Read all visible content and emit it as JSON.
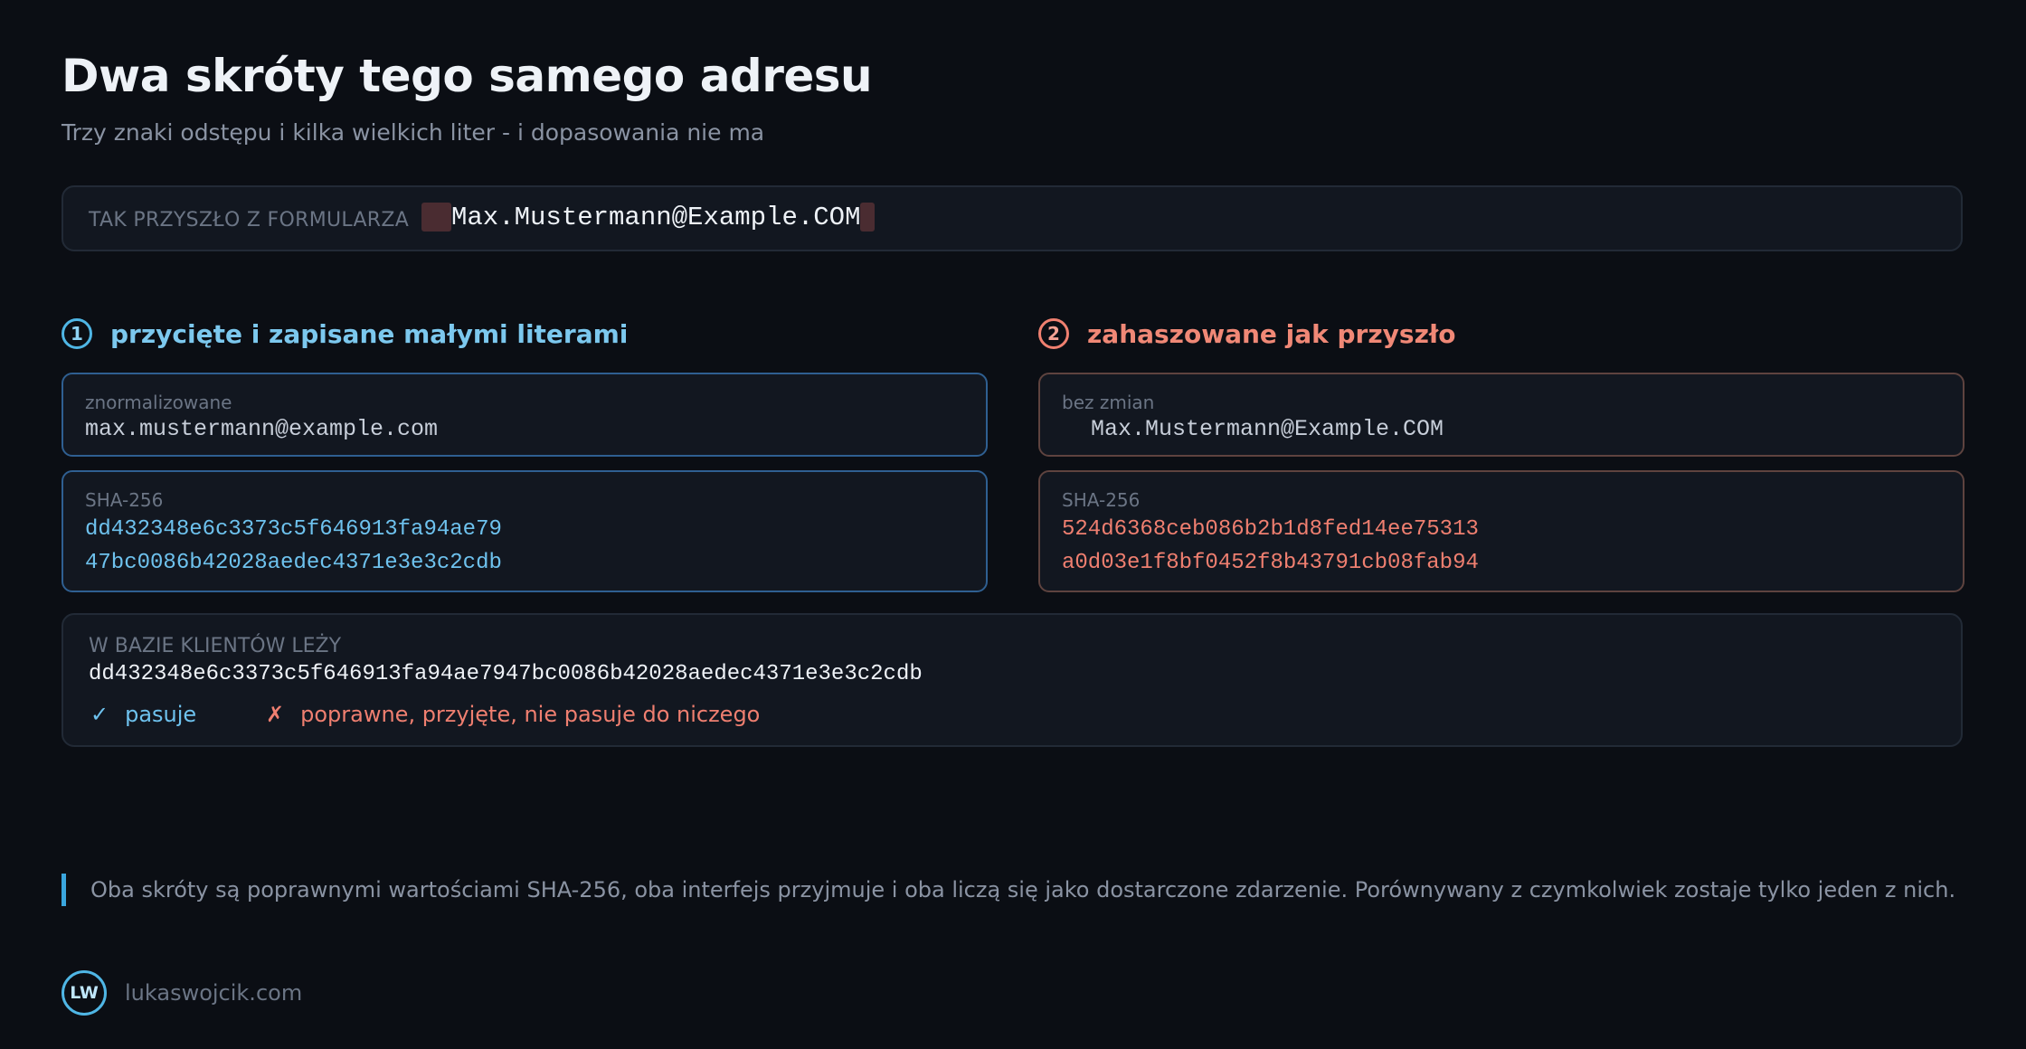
{
  "title": "Dwa skróty tego samego adresu",
  "subtitle": "Trzy znaki odstępu i kilka wielkich liter - i dopasowania nie ma",
  "input": {
    "label": "TAK PRZYSZŁO Z FORMULARZA",
    "value": "Max.Mustermann@Example.COM"
  },
  "left": {
    "number": "1",
    "title": "przycięte i zapisane małymi literami",
    "value_label": "znormalizowane",
    "value": "max.mustermann@example.com",
    "hash_label": "SHA-256",
    "hash_line1": "dd432348e6c3373c5f646913fa94ae79",
    "hash_line2": "47bc0086b42028aedec4371e3e3c2cdb"
  },
  "right": {
    "number": "2",
    "title": "zahaszowane jak przyszło",
    "value_label": "bez zmian",
    "value": "Max.Mustermann@Example.COM",
    "hash_label": "SHA-256",
    "hash_line1": "524d6368ceb086b2b1d8fed14ee75313",
    "hash_line2": "a0d03e1f8bf0452f8b43791cb08fab94"
  },
  "database": {
    "label": "W BAZIE KLIENTÓW LEŻY",
    "hash": "dd432348e6c3373c5f646913fa94ae7947bc0086b42028aedec4371e3e3c2cdb",
    "match_mark": "✓",
    "match_text": "pasuje",
    "nomatch_mark": "✗",
    "nomatch_text": "poprawne, przyjęte, nie pasuje do niczego"
  },
  "note": "Oba skróty są poprawnymi wartościami SHA-256, oba interfejs przyjmuje i oba liczą się jako dostarczone zdarzenie. Porównywany z czymkolwiek zostaje tylko jeden z nich.",
  "footer": {
    "logo": "LW",
    "site": "lukaswojcik.com"
  },
  "colors": {
    "background": "#0b0e14",
    "accent_blue": "#4fb6e5",
    "accent_red": "#f08070"
  }
}
